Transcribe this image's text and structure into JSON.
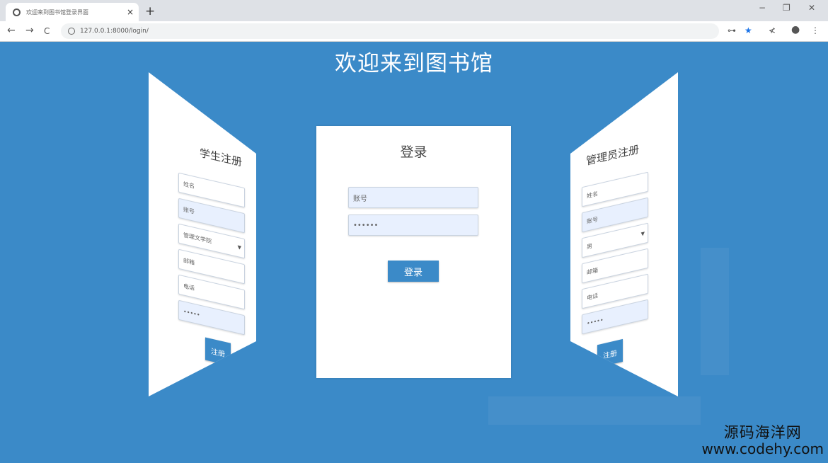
{
  "browser": {
    "tab_title": "欢迎来到图书馆登录界面",
    "tab_close": "×",
    "new_tab": "+",
    "url": "127.0.0.1:8000/login/",
    "window_controls": {
      "minimize": "−",
      "restore": "❐",
      "close": "✕"
    },
    "nav": {
      "back": "←",
      "forward": "→",
      "reload": "C"
    },
    "toolbar_icons": {
      "key": "⊶",
      "star": "★",
      "extension": "≮",
      "profile": "●",
      "menu": "⋮"
    }
  },
  "page": {
    "title": "欢迎来到图书馆"
  },
  "login_panel": {
    "title": "登录",
    "username_placeholder": "账号",
    "password_value": "••••••",
    "submit_label": "登录"
  },
  "student_register_panel": {
    "title": "学生注册",
    "fields": [
      "姓名",
      "账号",
      "管理文学院",
      "邮箱",
      "电话",
      "•••••"
    ],
    "submit_label": "注册"
  },
  "admin_register_panel": {
    "title": "管理员注册",
    "fields": [
      "姓名",
      "账号",
      "男",
      "邮箱",
      "电话",
      "•••••"
    ],
    "submit_label": "注册"
  },
  "watermark": {
    "cn": "源码海洋网",
    "en": "www.codehy.com"
  },
  "colors": {
    "background": "#3b8ac8",
    "button": "#3b8ac8",
    "input_bg": "#e8f0fe"
  }
}
